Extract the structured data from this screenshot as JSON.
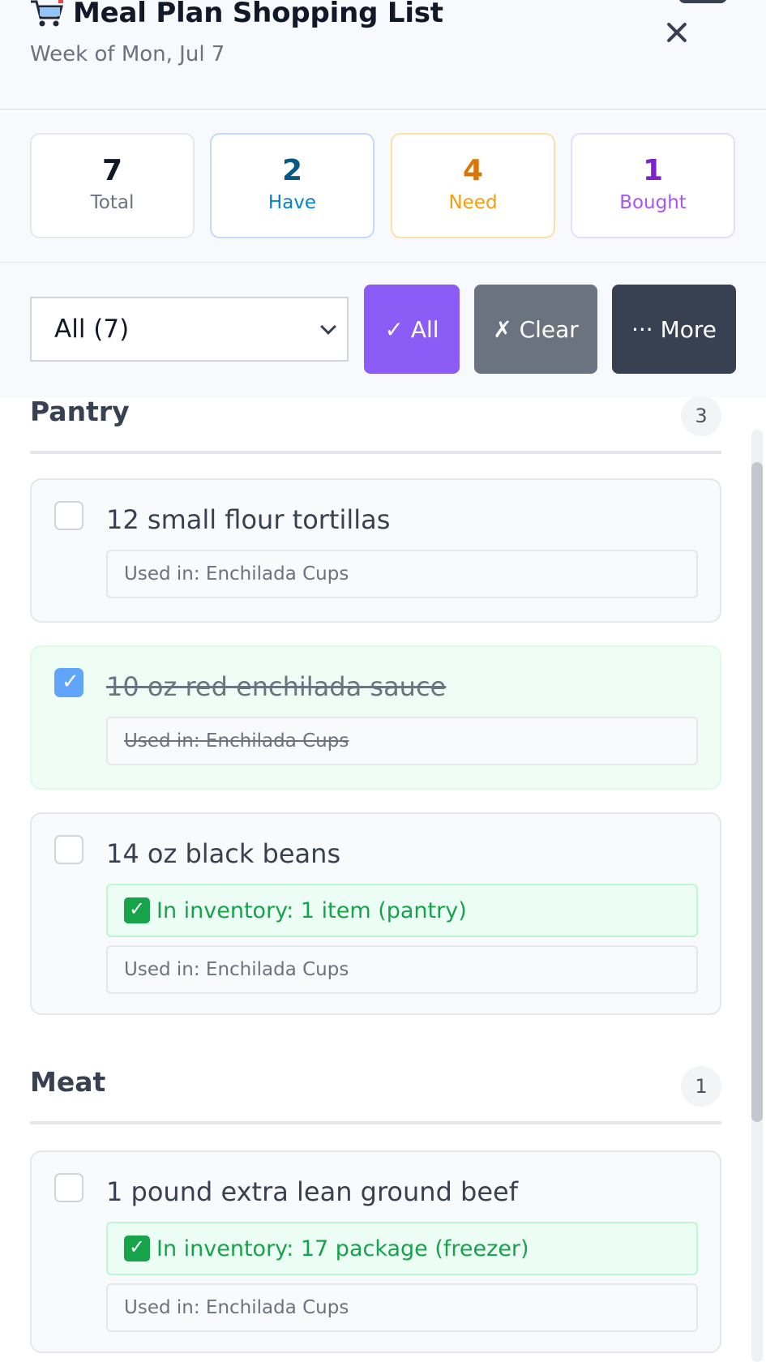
{
  "header": {
    "title": "Meal Plan Shopping List",
    "subtitle": "Week of Mon, Jul 7"
  },
  "stats": {
    "total": {
      "value": "7",
      "label": "Total"
    },
    "have": {
      "value": "2",
      "label": "Have"
    },
    "need": {
      "value": "4",
      "label": "Need"
    },
    "bought": {
      "value": "1",
      "label": "Bought"
    }
  },
  "toolbar": {
    "filter_value": "All (7)",
    "all_label": "✓ All",
    "clear_label": "✗ Clear",
    "more_label": "··· More"
  },
  "categories": [
    {
      "name": "Pantry",
      "count": "3",
      "items": [
        {
          "name": "12 small flour tortillas",
          "used_in": "Used in: Enchilada Cups",
          "checked": false
        },
        {
          "name": "10 oz red enchilada sauce",
          "used_in": "Used in: Enchilada Cups",
          "checked": true
        },
        {
          "name": "14 oz black beans",
          "inventory": "In inventory: 1 item (pantry)",
          "used_in": "Used in: Enchilada Cups",
          "checked": false
        }
      ]
    },
    {
      "name": "Meat",
      "count": "1",
      "items": [
        {
          "name": "1 pound extra lean ground beef",
          "inventory": "In inventory: 17 package (freezer)",
          "used_in": "Used in: Enchilada Cups",
          "checked": false
        }
      ]
    }
  ]
}
